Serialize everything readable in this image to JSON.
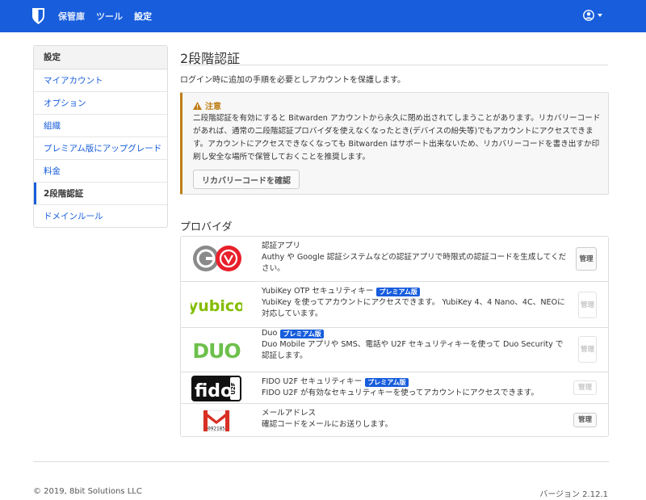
{
  "nav": {
    "links": [
      "保管庫",
      "ツール",
      "設定"
    ]
  },
  "sidebar": {
    "heading": "設定",
    "items": [
      {
        "label": "マイアカウント"
      },
      {
        "label": "オプション"
      },
      {
        "label": "組織"
      },
      {
        "label": "プレミアム版にアップグレード"
      },
      {
        "label": "料金"
      },
      {
        "label": "2段階認証",
        "active": true
      },
      {
        "label": "ドメインルール"
      }
    ]
  },
  "main": {
    "title": "2段階認証",
    "intro": "ログイン時に追加の手順を必要としアカウントを保護します。",
    "warning": {
      "title": "注意",
      "text": "二段階認証を有効にすると Bitwarden アカウントから永久に閉め出されてしまうことがあります。リカバリーコードがあれば、通常の二段階認証プロバイダを使えなくなったとき(デバイスの紛失等)でもアカウントにアクセスできます。アカウントにアクセスできなくなっても Bitwarden はサポート出来ないため、リカバリーコードを書き出すか印刷し安全な場所で保管しておくことを推奨します。",
      "button": "リカバリーコードを確認",
      "color": "#bf7e16"
    },
    "providers_heading": "プロバイダ",
    "providers": [
      {
        "name": "認証アプリ",
        "badge": "",
        "desc": "Authy や Google 認証システムなどの認証アプリで時限式の認証コードを生成してください。",
        "manage": "管理",
        "enabled": true,
        "logo": "authenticator-logo"
      },
      {
        "name": "YubiKey OTP セキュリティキー",
        "badge": "プレミアム版",
        "desc": "YubiKey を使ってアカウントにアクセスできます。 YubiKey 4、4 Nano、4C、NEOに対応しています。",
        "manage": "管理",
        "enabled": false,
        "logo_text": "yubico"
      },
      {
        "name": "Duo",
        "badge": "プレミアム版",
        "desc": "Duo Mobile アプリや SMS、電話や U2F セキュリティキーを使って Duo Security で認証します。",
        "manage": "管理",
        "enabled": false,
        "logo_text": "DUO"
      },
      {
        "name": "FIDO U2F セキュリティキー",
        "badge": "プレミアム版",
        "desc": "FIDO U2F が有効なセキュリティキーを使ってアカウントにアクセスできます。",
        "manage": "管理",
        "enabled": false,
        "logo_text": "fido",
        "logo_sub": "U2F"
      },
      {
        "name": "メールアドレス",
        "badge": "",
        "desc": "確認コードをメールにお送りします。",
        "manage": "管理",
        "enabled": true,
        "logo_text": "092185"
      }
    ]
  },
  "footer": {
    "copyright": "© 2019, 8bit Solutions LLC",
    "version": "バージョン 2.12.1"
  },
  "colors": {
    "brand": "#175ddc",
    "premium_badge": "#175ddc",
    "yubico": "#84bd00",
    "duo": "#6dc04b",
    "gmail_red": "#d93025"
  }
}
